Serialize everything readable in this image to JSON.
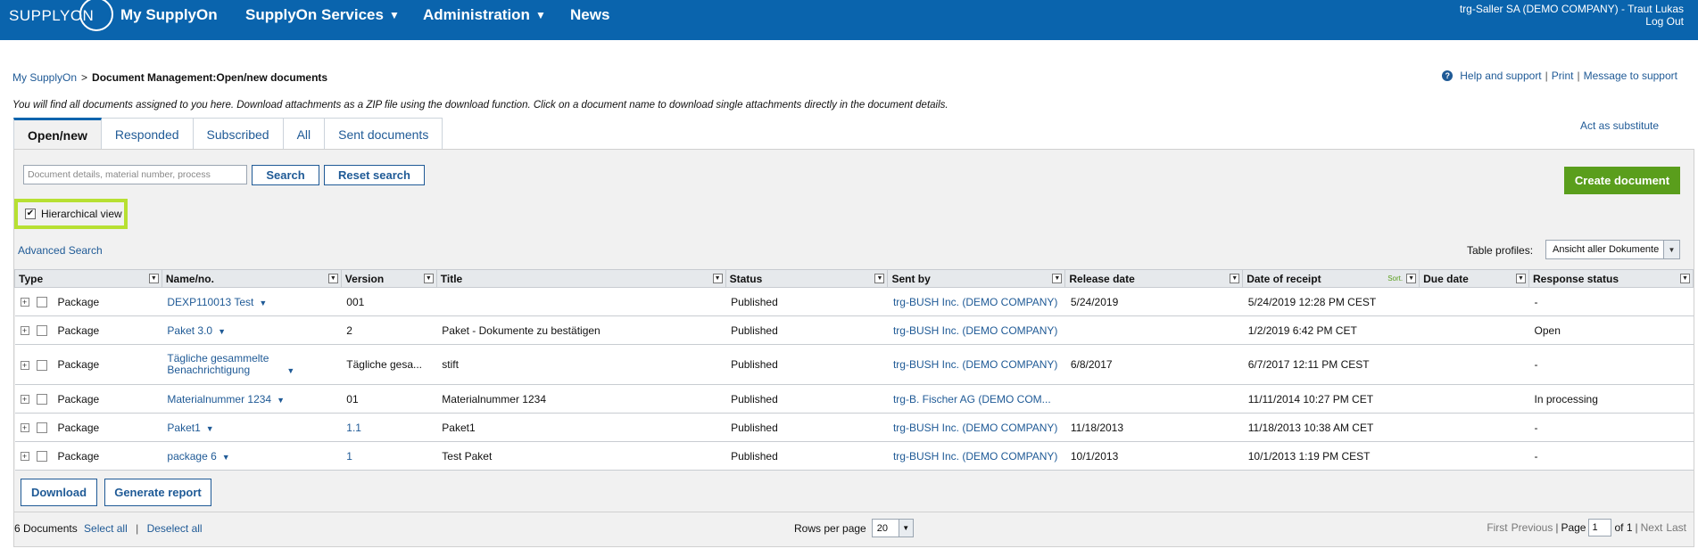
{
  "header": {
    "logo": "SUPPLYON",
    "nav": [
      {
        "label": "My SupplyOn",
        "caret": false
      },
      {
        "label": "SupplyOn Services",
        "caret": true
      },
      {
        "label": "Administration",
        "caret": true
      },
      {
        "label": "News",
        "caret": false
      }
    ],
    "user": "trg-Saller SA (DEMO COMPANY) - Traut Lukas",
    "logout": "Log Out"
  },
  "breadcrumb": {
    "root": "My SupplyOn",
    "sep": ">",
    "current": "Document Management:Open/new documents"
  },
  "help_links": {
    "help": "Help and support",
    "print": "Print",
    "message": "Message to support"
  },
  "info_text": "You will find all documents assigned to you here. Download attachments as a ZIP file using the download function. Click on a document name to download single attachments directly in the document details.",
  "tabs": [
    "Open/new",
    "Responded",
    "Subscribed",
    "All",
    "Sent documents"
  ],
  "act_as_substitute": "Act as substitute",
  "search": {
    "placeholder": "Document details, material number, process",
    "search_label": "Search",
    "reset_label": "Reset search"
  },
  "create_document": "Create document",
  "hierarchical_view": {
    "label": "Hierarchical view",
    "checked": true
  },
  "advanced_search": "Advanced Search",
  "table_profiles": {
    "label": "Table profiles:",
    "value": "Ansicht aller Dokumente"
  },
  "table": {
    "sort_label": "Sort.",
    "columns": [
      "Type",
      "Name/no.",
      "Version",
      "Title",
      "Status",
      "Sent by",
      "Release date",
      "Date of receipt",
      "Due date",
      "Response status"
    ],
    "rows": [
      {
        "type": "Package",
        "name": "DEXP110013 Test",
        "version": "001",
        "title": "",
        "status": "Published",
        "sent_by": "trg-BUSH Inc. (DEMO COMPANY)",
        "release_date": "5/24/2019",
        "date_of_receipt": "5/24/2019 12:28 PM CEST",
        "due_date": "",
        "response_status": "-"
      },
      {
        "type": "Package",
        "name": "Paket 3.0",
        "version": "2",
        "title": "Paket - Dokumente zu bestätigen",
        "status": "Published",
        "sent_by": "trg-BUSH Inc. (DEMO COMPANY)",
        "release_date": "",
        "date_of_receipt": "1/2/2019 6:42 PM CET",
        "due_date": "",
        "response_status": "Open"
      },
      {
        "type": "Package",
        "name": "Tägliche gesammelte Benachrichtigung",
        "version": "Tägliche gesa...",
        "title": "stift",
        "status": "Published",
        "sent_by": "trg-BUSH Inc. (DEMO COMPANY)",
        "release_date": "6/8/2017",
        "date_of_receipt": "6/7/2017 12:11 PM CEST",
        "due_date": "",
        "response_status": "-"
      },
      {
        "type": "Package",
        "name": "Materialnummer 1234",
        "version": "01",
        "title": "Materialnummer 1234",
        "status": "Published",
        "sent_by": "trg-B. Fischer AG (DEMO COM...",
        "release_date": "",
        "date_of_receipt": "11/11/2014 10:27 PM CET",
        "due_date": "",
        "response_status": "In processing"
      },
      {
        "type": "Package",
        "name": "Paket1",
        "version": "1.1",
        "title": "Paket1",
        "status": "Published",
        "sent_by": "trg-BUSH Inc. (DEMO COMPANY)",
        "release_date": "11/18/2013",
        "date_of_receipt": "11/18/2013 10:38 AM CET",
        "due_date": "",
        "response_status": "-"
      },
      {
        "type": "Package",
        "name": "package 6",
        "version": "1",
        "title": "Test Paket",
        "status": "Published",
        "sent_by": "trg-BUSH Inc. (DEMO COMPANY)",
        "release_date": "10/1/2013",
        "date_of_receipt": "10/1/2013 1:19 PM CEST",
        "due_date": "",
        "response_status": "-"
      }
    ]
  },
  "buttons": {
    "download": "Download",
    "report": "Generate report"
  },
  "footer": {
    "count": "6 Documents",
    "select_all": "Select all",
    "deselect_all": "Deselect all",
    "rows_per_page_label": "Rows per page",
    "rows_per_page_value": "20",
    "first": "First",
    "previous": "Previous",
    "page_label": "Page",
    "page_value": "1",
    "of_label": "of 1",
    "next": "Next",
    "last": "Last"
  },
  "colors": {
    "brand_blue": "#0a64ad",
    "link_blue": "#1f5a96",
    "green": "#5a9e1c",
    "highlight": "#b7e032"
  }
}
